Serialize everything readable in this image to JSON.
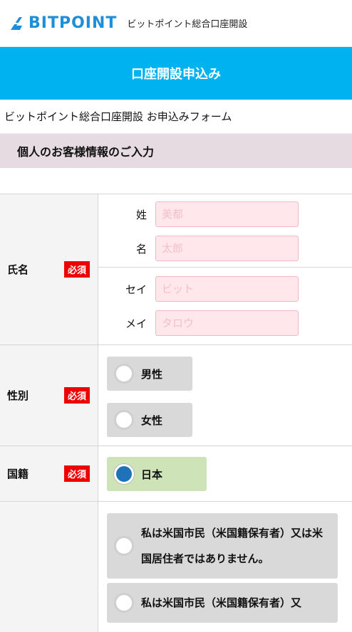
{
  "header": {
    "logo_text": "BITPOINT",
    "subtitle": "ビットポイント総合口座開設"
  },
  "titlebar": {
    "title": "口座開設申込み"
  },
  "form_name": "ビットポイント総合口座開設 お申込みフォーム",
  "section": {
    "title": "個人のお客様情報のご入力"
  },
  "required_badge": "必須",
  "name_row": {
    "label": "氏名",
    "last_name": {
      "label": "姓",
      "placeholder": "美都"
    },
    "first_name": {
      "label": "名",
      "placeholder": "太郎"
    },
    "last_name_kana": {
      "label": "セイ",
      "placeholder": "ビット"
    },
    "first_name_kana": {
      "label": "メイ",
      "placeholder": "タロウ"
    }
  },
  "gender_row": {
    "label": "性別",
    "options": [
      "男性",
      "女性"
    ]
  },
  "nationality_row": {
    "label": "国籍",
    "selected": "日本"
  },
  "us_row": {
    "options": [
      "私は米国市民（米国籍保有者）又は米国居住者ではありません。",
      "私は米国市民（米国籍保有者）又"
    ]
  },
  "colors": {
    "brand_blue": "#1e8fd6",
    "title_bar": "#00b2f0",
    "required_red": "#ee0000",
    "selected_green": "#cfe3b8"
  }
}
